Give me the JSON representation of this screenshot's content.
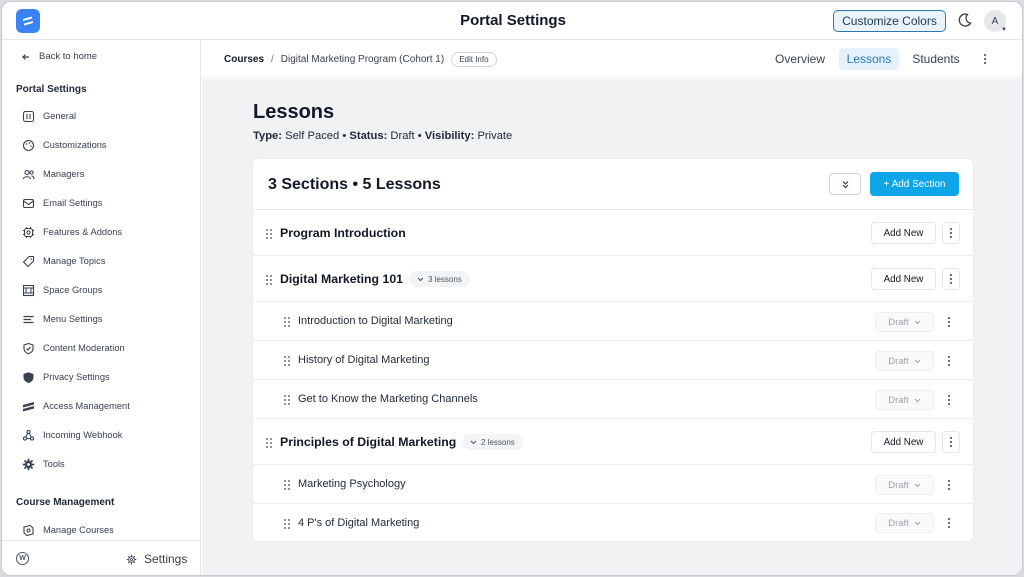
{
  "topbar": {
    "title": "Portal Settings",
    "customize_label": "Customize Colors",
    "avatar_initial": "A"
  },
  "sidebar": {
    "back_label": "Back to home",
    "portal_settings_title": "Portal Settings",
    "items": [
      {
        "label": "General",
        "icon": "general-icon"
      },
      {
        "label": "Customizations",
        "icon": "palette-icon"
      },
      {
        "label": "Managers",
        "icon": "users-icon"
      },
      {
        "label": "Email Settings",
        "icon": "mail-icon"
      },
      {
        "label": "Features & Addons",
        "icon": "chip-icon"
      },
      {
        "label": "Manage Topics",
        "icon": "tag-icon"
      },
      {
        "label": "Space Groups",
        "icon": "grid-icon"
      },
      {
        "label": "Menu Settings",
        "icon": "menu-icon"
      },
      {
        "label": "Content Moderation",
        "icon": "shield-check-icon"
      },
      {
        "label": "Privacy Settings",
        "icon": "shield-icon"
      },
      {
        "label": "Access Management",
        "icon": "access-icon"
      },
      {
        "label": "Incoming Webhook",
        "icon": "webhook-icon"
      },
      {
        "label": "Tools",
        "icon": "gear-icon"
      }
    ],
    "course_management_title": "Course Management",
    "course_items": [
      {
        "label": "Manage Courses",
        "icon": "courses-icon"
      }
    ],
    "settings_label": "Settings"
  },
  "header": {
    "breadcrumb_root": "Courses",
    "breadcrumb_separator": "/",
    "breadcrumb_current": "Digital Marketing Program (Cohort 1)",
    "edit_info_label": "Edit Info",
    "tabs": [
      {
        "label": "Overview"
      },
      {
        "label": "Lessons",
        "active": true
      },
      {
        "label": "Students"
      }
    ]
  },
  "main": {
    "title": "Lessons",
    "meta": {
      "type_label": "Type:",
      "type_value": "Self Paced",
      "status_label": "Status:",
      "status_value": "Draft",
      "visibility_label": "Visibility:",
      "visibility_value": "Private",
      "dot": "•"
    },
    "summary": "3 Sections • 5 Lessons",
    "add_section_label": "+ Add Section",
    "add_new_label": "Add New",
    "draft_label": "Draft",
    "sections": [
      {
        "title": "Program Introduction",
        "badge": "",
        "lessons": []
      },
      {
        "title": "Digital Marketing 101",
        "badge": "3 lessons",
        "lessons": [
          "Introduction to Digital Marketing",
          "History of Digital Marketing",
          "Get to Know the Marketing Channels"
        ]
      },
      {
        "title": "Principles of Digital Marketing",
        "badge": "2 lessons",
        "lessons": [
          "Marketing Psychology",
          "4 P's of Digital Marketing"
        ]
      }
    ]
  },
  "colors": {
    "accent": "#0ea5e9",
    "tab_active": "#2b78b4",
    "logo": "#3b82f6"
  }
}
